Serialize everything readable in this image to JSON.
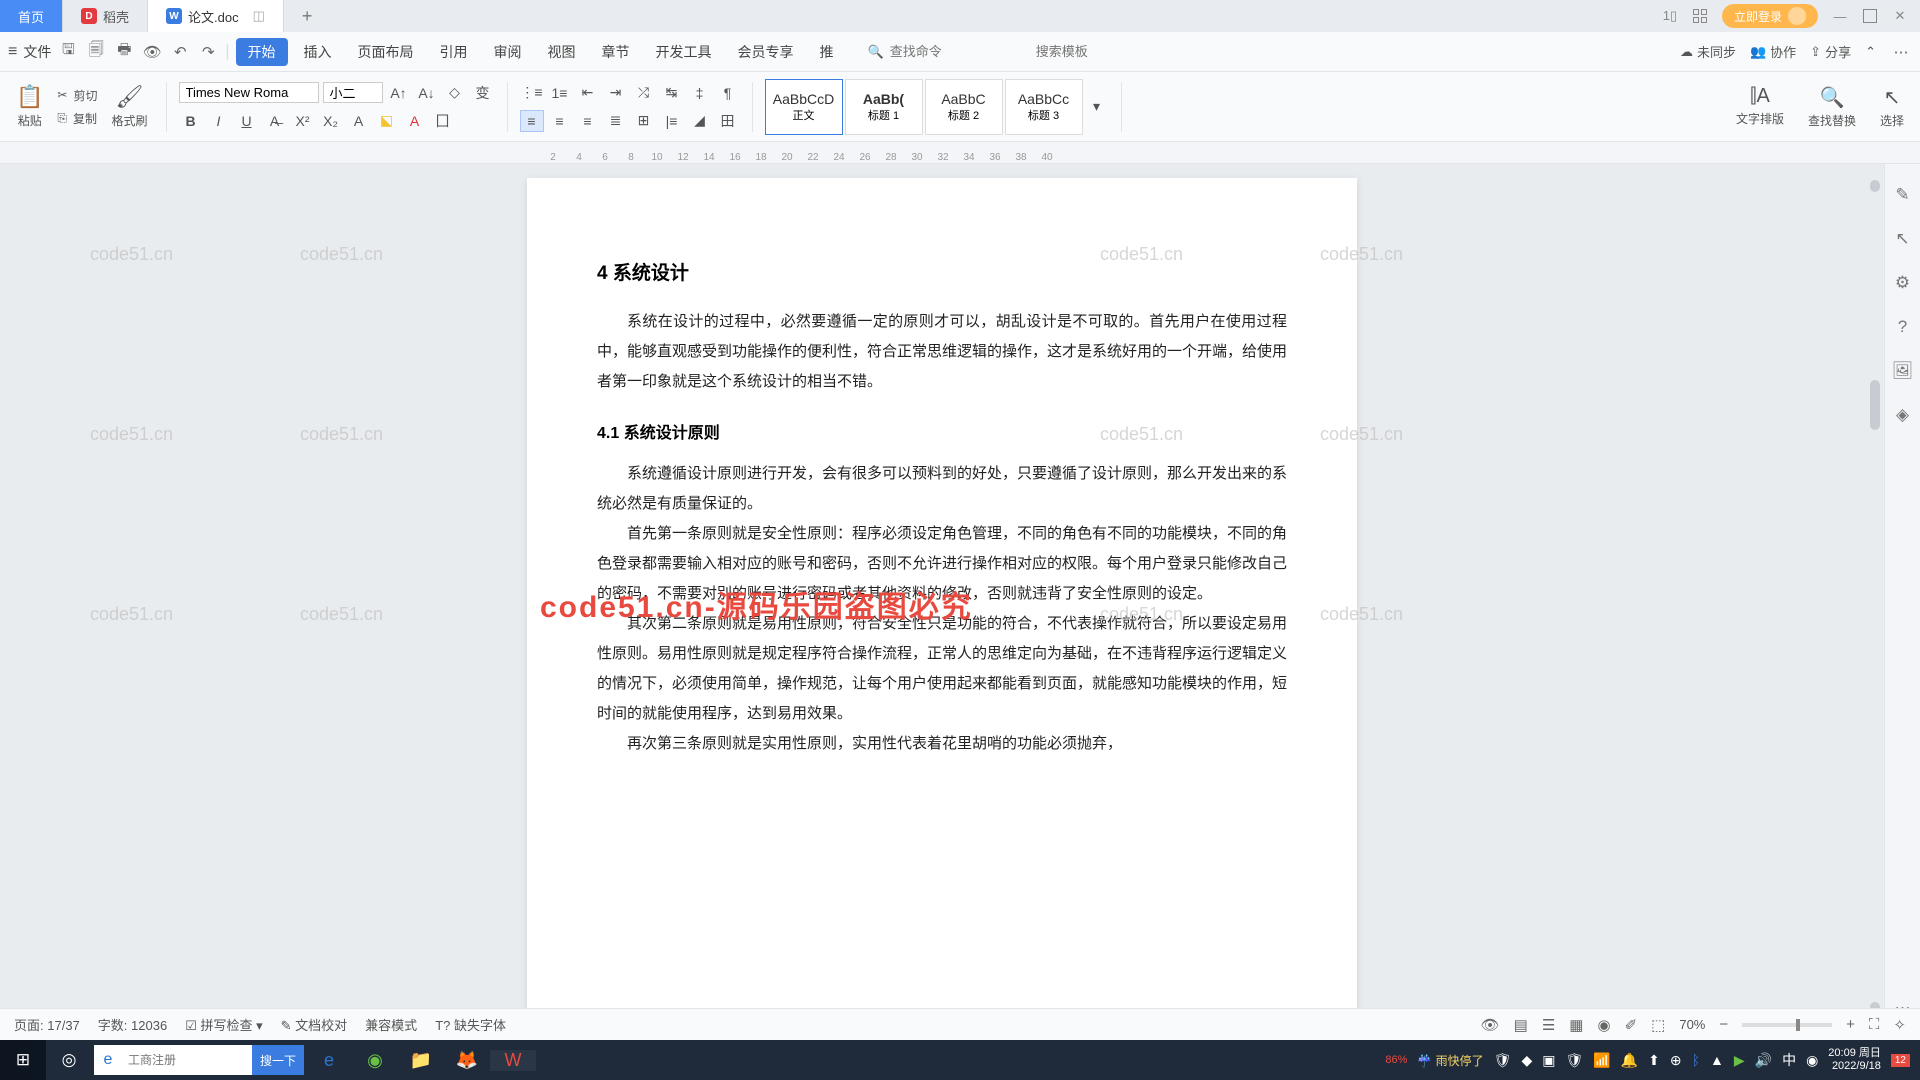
{
  "tabs": {
    "home": "首页",
    "dao": "稻壳",
    "doc": "论文.doc"
  },
  "topright": {
    "login": "立即登录"
  },
  "file": "文件",
  "menus": [
    "开始",
    "插入",
    "页面布局",
    "引用",
    "审阅",
    "视图",
    "章节",
    "开发工具",
    "会员专享",
    "推"
  ],
  "search": {
    "ph1": "查找命令",
    "ph2": "搜索模板"
  },
  "menuright": {
    "sync": "未同步",
    "coop": "协作",
    "share": "分享"
  },
  "ribbon": {
    "paste": "粘贴",
    "cut": "剪切",
    "copy": "复制",
    "format": "格式刷",
    "font": "Times New Roma",
    "size": "小二",
    "styles": [
      {
        "samp": "AaBbCcD",
        "name": "正文"
      },
      {
        "samp": "AaBb(",
        "name": "标题 1"
      },
      {
        "samp": "AaBbC",
        "name": "标题 2"
      },
      {
        "samp": "AaBbCc",
        "name": "标题 3"
      }
    ],
    "layout": "文字排版",
    "find": "查找替换",
    "select": "选择"
  },
  "ruler": [
    "2",
    "4",
    "6",
    "8",
    "10",
    "12",
    "14",
    "16",
    "18",
    "20",
    "22",
    "24",
    "26",
    "28",
    "30",
    "32",
    "34",
    "36",
    "38",
    "40"
  ],
  "doc": {
    "h2": "4  系统设计",
    "p1": "系统在设计的过程中，必然要遵循一定的原则才可以，胡乱设计是不可取的。首先用户在使用过程中，能够直观感受到功能操作的便利性，符合正常思维逻辑的操作，这才是系统好用的一个开端，给使用者第一印象就是这个系统设计的相当不错。",
    "h3": "4.1  系统设计原则",
    "p2": "系统遵循设计原则进行开发，会有很多可以预料到的好处，只要遵循了设计原则，那么开发出来的系统必然是有质量保证的。",
    "p3": "首先第一条原则就是安全性原则：程序必须设定角色管理，不同的角色有不同的功能模块，不同的角色登录都需要输入相对应的账号和密码，否则不允许进行操作相对应的权限。每个用户登录只能修改自己的密码，不需要对别的账号进行密码或者其他资料的修改，否则就违背了安全性原则的设定。",
    "p4": "其次第二条原则就是易用性原则，符合安全性只是功能的符合，不代表操作就符合，所以要设定易用性原则。易用性原则就是规定程序符合操作流程，正常人的思维定向为基础，在不违背程序运行逻辑定义的情况下，必须使用简单，操作规范，让每个用户使用起来都能看到页面，就能感知功能模块的作用，短时间的就能使用程序，达到易用效果。",
    "p5": "再次第三条原则就是实用性原则，实用性代表着花里胡哨的功能必须抛弃，"
  },
  "watermark": "code51.cn",
  "wmred": "code51.cn-源码乐园盗图必究",
  "status": {
    "page_lbl": "页面:",
    "page": "17/37",
    "words_lbl": "字数:",
    "words": "12036",
    "spell": "拼写检查",
    "proof": "文档校对",
    "compat": "兼容模式",
    "missfont": "缺失字体",
    "zoom": "70%"
  },
  "taskbar": {
    "search_ph": "工商注册",
    "search_btn": "搜一下",
    "weather": "雨快停了",
    "time": "20:09 周日",
    "date": "2022/9/18",
    "notif": "12",
    "pct": "86%"
  }
}
